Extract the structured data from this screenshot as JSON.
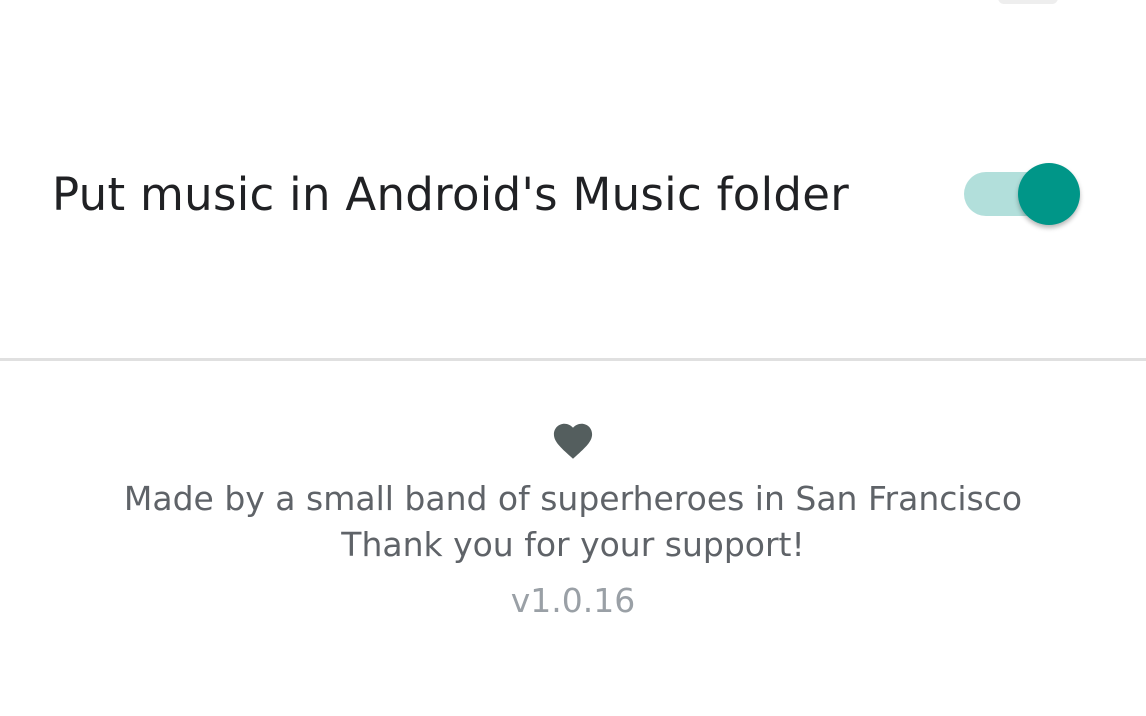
{
  "settings": {
    "music_folder": {
      "label": "Put music in Android's Music folder",
      "enabled": true
    }
  },
  "footer": {
    "icon": "heart-icon",
    "line1": "Made by a small band of superheroes in San Francisco",
    "line2": "Thank you for your support!",
    "version": "v1.0.16"
  },
  "colors": {
    "accent": "#009688",
    "track_on": "#b2dfdb",
    "heart": "#545e5e",
    "text_primary": "#202124",
    "text_secondary": "#5f6368",
    "text_muted": "#9aa0a6",
    "divider": "#e0e0e0"
  }
}
